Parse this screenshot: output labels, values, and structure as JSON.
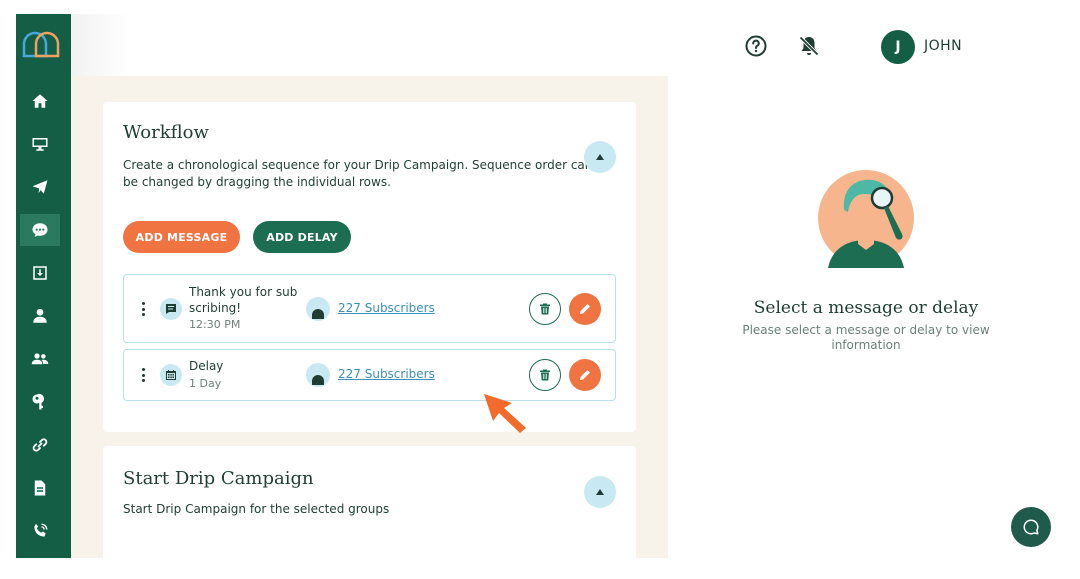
{
  "header": {
    "help_icon": "help-circle-icon",
    "notifications_icon": "bell-off-icon",
    "avatar_initial": "J",
    "username": "JOHN",
    "more_icon": "vertical-dots-icon"
  },
  "sidebar": {
    "items": [
      {
        "icon": "home-icon",
        "active": false
      },
      {
        "icon": "monitor-icon",
        "active": false
      },
      {
        "icon": "send-icon",
        "active": false
      },
      {
        "icon": "chat-icon",
        "active": true
      },
      {
        "icon": "inbox-icon",
        "active": false
      },
      {
        "icon": "user-icon",
        "active": false
      },
      {
        "icon": "group-icon",
        "active": false
      },
      {
        "icon": "key-icon",
        "active": false
      },
      {
        "icon": "link-icon",
        "active": false
      },
      {
        "icon": "document-icon",
        "active": false
      },
      {
        "icon": "phone-icon",
        "active": false
      }
    ]
  },
  "workflow": {
    "title": "Workflow",
    "description": "Create a chronological sequence for your Drip Campaign. Sequence order can be changed by dragging the individual rows.",
    "add_message_label": "ADD MESSAGE",
    "add_delay_label": "ADD DELAY",
    "rows": [
      {
        "type": "message",
        "name_line1": "Thank you for sub",
        "name_line2": "scribing!",
        "detail": "12:30 PM",
        "subscribers": "227 Subscribers"
      },
      {
        "type": "delay",
        "name_line1": "Delay",
        "detail": "1 Day",
        "subscribers": "227 Subscribers"
      }
    ]
  },
  "drip": {
    "title": "Start Drip Campaign",
    "description": "Start Drip Campaign for the selected groups"
  },
  "empty_state": {
    "title": "Select a message or delay",
    "description": "Please select a message or delay to view information"
  },
  "colors": {
    "brand_green": "#135e45",
    "accent_orange": "#f07342",
    "light_blue": "#c8e9f2",
    "content_bg": "#f8f3ea"
  }
}
